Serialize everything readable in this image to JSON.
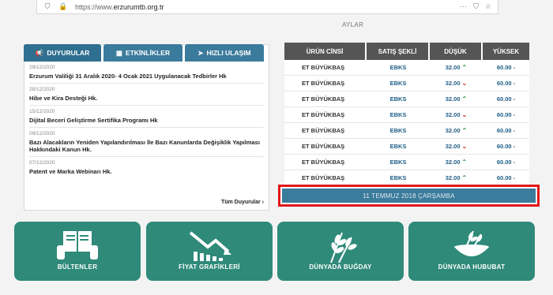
{
  "browser": {
    "url_prefix": "https://www.",
    "url_domain": "erzurumtb.org.tr",
    "menu": "···"
  },
  "months_label": "AYLAR",
  "news": {
    "tabs": [
      {
        "label": "DUYURULAR"
      },
      {
        "label": "ETKİNLİKLER"
      },
      {
        "label": "HIZLI ULAŞIM"
      }
    ],
    "items": [
      {
        "date": "29/12/2020",
        "title": "Erzurum Valiliği 31 Aralık 2020- 4 Ocak 2021 Uygulanacak Tedbirler Hk"
      },
      {
        "date": "28/12/2020",
        "title": "Hibe ve Kira Desteği Hk."
      },
      {
        "date": "15/12/2020",
        "title": "Dijital Beceri Geliştirme Sertifika Programı Hk"
      },
      {
        "date": "09/12/2020",
        "title": "Bazı Alacakların Yeniden Yapılandırılması İle Bazı Kanunlarda Değişiklik Yapılması Hakkındaki Kanun Hk."
      },
      {
        "date": "07/12/2020",
        "title": "Patent ve Marka Webinarı Hk."
      }
    ],
    "all_link": "Tüm Duyurular ›"
  },
  "prices": {
    "headers": [
      "ÜRÜN CİNSİ",
      "SATIŞ ŞEKLİ",
      "DÜŞÜK",
      "YÜKSEK"
    ],
    "rows": [
      {
        "product": "ET BÜYÜKBAŞ",
        "sale": "EBKS",
        "low": "32.00",
        "trend": "up",
        "high": "60.00 -"
      },
      {
        "product": "ET BÜYÜKBAŞ",
        "sale": "EBKS",
        "low": "32.00",
        "trend": "down",
        "high": "60.00 -"
      },
      {
        "product": "ET BÜYÜKBAŞ",
        "sale": "EBKS",
        "low": "32.00",
        "trend": "up",
        "high": "60.00 -"
      },
      {
        "product": "ET BÜYÜKBAŞ",
        "sale": "EBKS",
        "low": "32.00",
        "trend": "down",
        "high": "60.00 -"
      },
      {
        "product": "ET BÜYÜKBAŞ",
        "sale": "EBKS",
        "low": "32.00",
        "trend": "up",
        "high": "60.00 -"
      },
      {
        "product": "ET BÜYÜKBAŞ",
        "sale": "EBKS",
        "low": "32.00",
        "trend": "down",
        "high": "60.00 -"
      },
      {
        "product": "ET BÜYÜKBAŞ",
        "sale": "EBKS",
        "low": "32.00",
        "trend": "up",
        "high": "60.00 -"
      },
      {
        "product": "ET BÜYÜKBAŞ",
        "sale": "EBKS",
        "low": "32.00",
        "trend": "up",
        "high": "60.00 -"
      }
    ],
    "date": "11 TEMMUZ 2018 ÇARŞAMBA"
  },
  "tiles": [
    {
      "label": "BÜLTENLER",
      "icon": "reader-icon"
    },
    {
      "label": "FİYAT GRAFİKLERİ",
      "icon": "chart-icon"
    },
    {
      "label": "DÜNYADA BUĞDAY",
      "icon": "wheat-icon"
    },
    {
      "label": "DÜNYADA HUBUBAT",
      "icon": "grain-bowl-icon"
    }
  ],
  "colors": {
    "accent": "#3b7b9c",
    "tile": "#2f8a7a",
    "header": "#555555",
    "highlight": "#e01818",
    "up": "#3a9a4a",
    "down": "#d03030"
  }
}
